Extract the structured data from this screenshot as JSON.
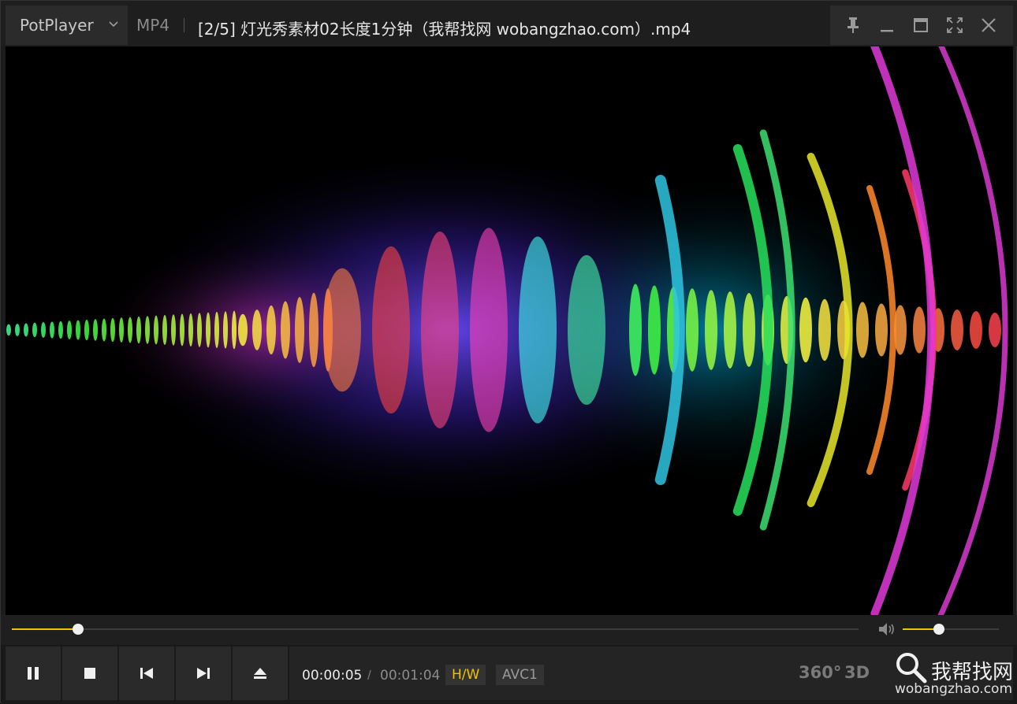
{
  "window": {
    "app_name": "PotPlayer",
    "format": "MP4",
    "title": "[2/5] 灯光秀素材02长度1分钟（我帮找网 wobangzhao.com）.mp4"
  },
  "playback": {
    "current_time": "00:00:05",
    "separator": "/",
    "duration": "00:01:04",
    "progress_fraction": 0.078,
    "volume_fraction": 0.38
  },
  "badges": {
    "hw": "H/W",
    "codec": "AVC1"
  },
  "extras": {
    "vr_label": "360°",
    "threed_label": "3D"
  },
  "watermark": {
    "brand_cn": "我帮找网",
    "url": "wobangzhao.com"
  },
  "icons": {
    "chevron": "chevron-down-icon",
    "pin": "pin-icon",
    "minimize": "minimize-icon",
    "maximize": "maximize-icon",
    "fullscreen": "fullscreen-icon",
    "close": "close-icon",
    "pause": "pause-icon",
    "stop": "stop-icon",
    "prev": "previous-icon",
    "next": "next-icon",
    "eject": "eject-icon",
    "volume": "speaker-icon"
  },
  "colors": {
    "accent": "#f2c200",
    "background": "#1c1c1c"
  }
}
